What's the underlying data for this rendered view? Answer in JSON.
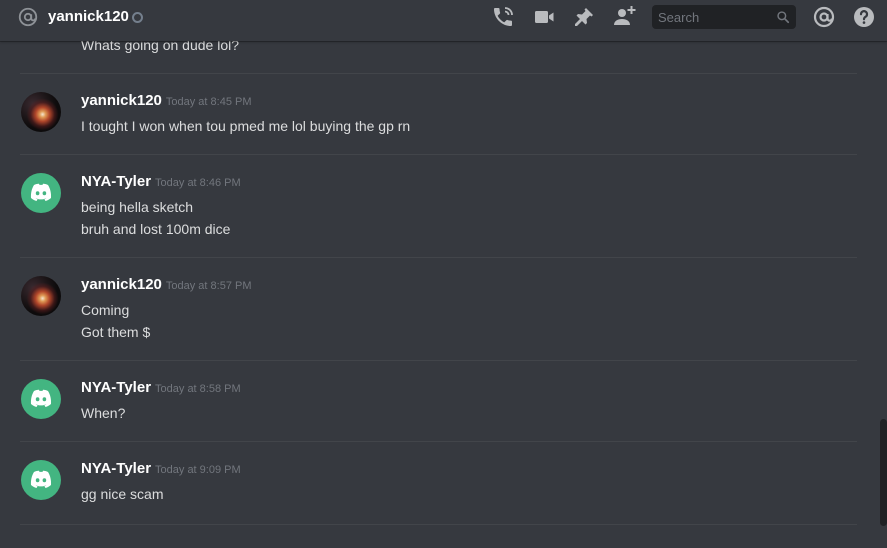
{
  "header": {
    "channel_name": "yannick120",
    "search_placeholder": "Search"
  },
  "colors": {
    "background": "#36393f",
    "discord_green": "#43b581",
    "timestamp": "#72767d"
  },
  "icons": {
    "at": "at-sign-icon",
    "call": "phone-call-icon",
    "video": "video-camera-icon",
    "pin": "pin-icon",
    "add_friend": "add-user-icon",
    "search": "search-icon",
    "mentions": "mentions-icon",
    "help": "help-icon"
  },
  "clipped_message": "Whats going on dude lol?",
  "messages": [
    {
      "author": "yannick120",
      "timestamp": "Today at 8:45 PM",
      "avatar": "galaxy-avatar",
      "lines": [
        "I tought I won when tou pmed me lol buying the gp rn"
      ]
    },
    {
      "author": "NYA-Tyler",
      "timestamp": "Today at 8:46 PM",
      "avatar": "discord-avatar",
      "lines": [
        "being hella sketch",
        "bruh and lost 100m dice"
      ]
    },
    {
      "author": "yannick120",
      "timestamp": "Today at 8:57 PM",
      "avatar": "galaxy-avatar",
      "lines": [
        "Coming",
        "Got them $"
      ]
    },
    {
      "author": "NYA-Tyler",
      "timestamp": "Today at 8:58 PM",
      "avatar": "discord-avatar",
      "lines": [
        "When?"
      ]
    },
    {
      "author": "NYA-Tyler",
      "timestamp": "Today at 9:09 PM",
      "avatar": "discord-avatar",
      "lines": [
        "gg nice scam"
      ]
    }
  ]
}
